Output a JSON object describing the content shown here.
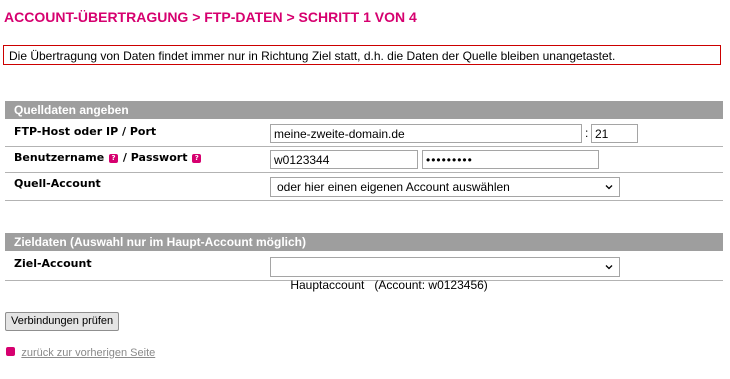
{
  "page_title": "ACCOUNT-ÜBERTRAGUNG > FTP-DATEN > SCHRITT 1 VON 4",
  "notice": "Die Übertragung von Daten findet immer nur in Richtung Ziel statt, d.h. die Daten der Quelle bleiben unangetastet.",
  "source": {
    "header": "Quelldaten angeben",
    "ftp_host_label": "FTP-Host oder IP / Port",
    "ftp_host_value": "meine-zweite-domain.de",
    "port_separator": ":",
    "port_value": "21",
    "username_label": "Benutzername",
    "password_label_sep": "/ Passwort",
    "username_value": "w0123344",
    "password_value": "•••••••••",
    "account_label": "Quell-Account",
    "account_selected": "oder hier einen eigenen Account auswählen"
  },
  "target": {
    "header": "Zieldaten (Auswahl nur im Haupt-Account möglich)",
    "account_label": "Ziel-Account",
    "account_selected": "Hauptaccount   (Account: w0123456)"
  },
  "check_button": "Verbindungen prüfen",
  "back_link": "zurück zur vorherigen Seite",
  "help_glyph": "?",
  "icons": {
    "help": "help-icon",
    "dropdown": "chevron-down-icon"
  },
  "colors": {
    "accent": "#d6006f",
    "header_bg": "#9e9e9e",
    "notice_border": "#cc0000"
  }
}
